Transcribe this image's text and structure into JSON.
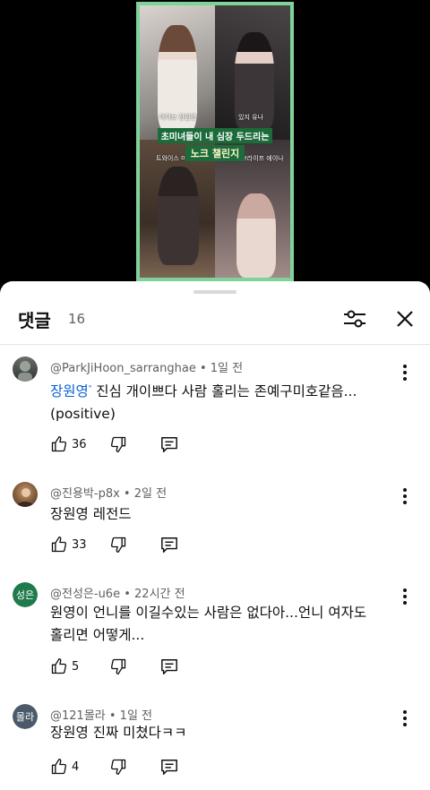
{
  "video": {
    "captions": {
      "tl": "아이브 장원영",
      "tr": "있지 유나",
      "bl": "트와이스 미호",
      "br": "키스오브라이프 에이나"
    },
    "banner_line1": "초미녀들이 내 심장 두드리는",
    "banner_line2": "노크 챌린지",
    "frame_color": "#7fd39a"
  },
  "sheet": {
    "title": "댓글",
    "count": "16",
    "filter_icon": "filter-icon",
    "close_icon": "close-icon"
  },
  "comments": [
    {
      "author": "@ParkJiHoon_sarranghae",
      "time": "1일 전",
      "mention": "장원영",
      "text": " 진심 개이쁘다 사람 홀리는 존예구미호같음...(positive)",
      "likes": "36"
    },
    {
      "author": "@진용박-p8x",
      "time": "2일 전",
      "text": "장원영 레전드",
      "likes": "33"
    },
    {
      "author": "@전성은-u6e",
      "time": "22시간 전",
      "avatar_text": "성은",
      "avatar_color": "#1f7a4c",
      "text": "원영이 언니를 이길수있는 사람은 없다아...언니 여자도 홀리면 어떻게...",
      "likes": "5"
    },
    {
      "author": "@121몰라",
      "time": "1일 전",
      "avatar_text": "몰라",
      "avatar_color": "#4a5a6a",
      "text": "장원영 진짜 미쳤다ㅋㅋ",
      "likes": "4"
    }
  ]
}
